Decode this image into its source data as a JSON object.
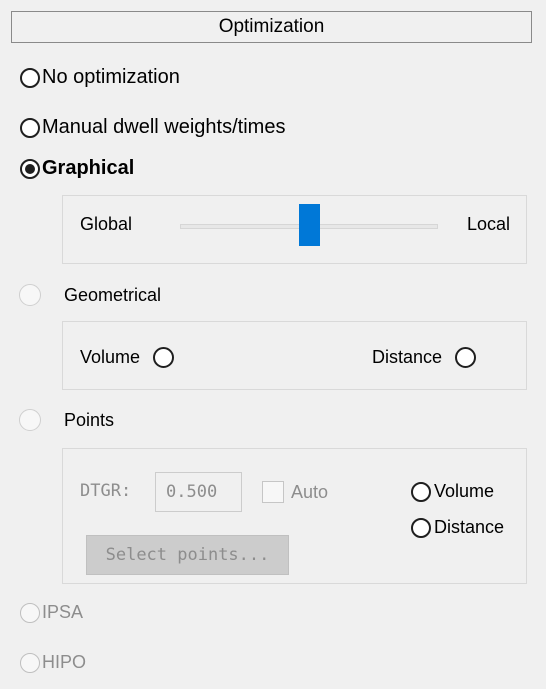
{
  "panel": {
    "title": "Optimization"
  },
  "options": {
    "no_optimization": "No optimization",
    "manual_dwell": "Manual dwell weights/times",
    "graphical": "Graphical",
    "geometrical": "Geometrical",
    "points": "Points",
    "ipsa": "IPSA",
    "hipo": "HIPO",
    "selected": "graphical"
  },
  "graphical_group": {
    "left_label": "Global",
    "right_label": "Local",
    "slider_value": 0.5
  },
  "geometrical_group": {
    "volume_label": "Volume",
    "distance_label": "Distance"
  },
  "points_group": {
    "dtgr_label": "DTGR:",
    "dtgr_value": "0.500",
    "auto_label": "Auto",
    "volume_label": "Volume",
    "distance_label": "Distance",
    "select_button": "Select points..."
  }
}
